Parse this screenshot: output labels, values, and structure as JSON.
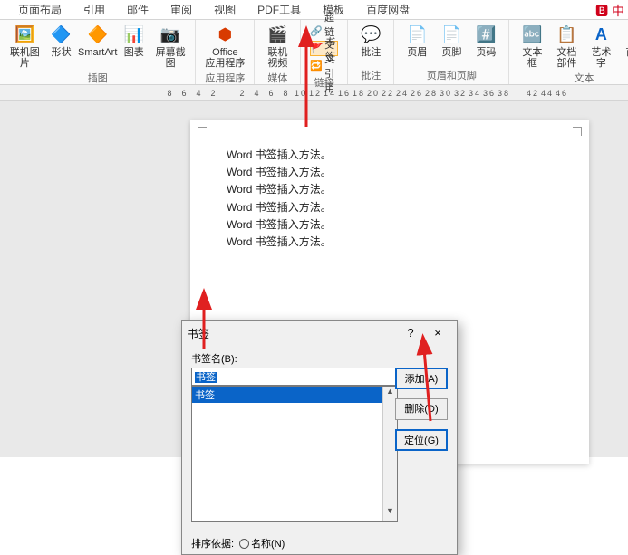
{
  "tabs": {
    "t0": "页面布局",
    "t1": "引用",
    "t2": "邮件",
    "t3": "审阅",
    "t4": "视图",
    "t5": "PDF工具",
    "t6": "模板",
    "t7": "百度网盘"
  },
  "logo_text": "中",
  "ribbon": {
    "illustrations": {
      "pic": "联机图片",
      "shape": "形状",
      "smartart": "SmartArt",
      "chart": "图表",
      "screenshot": "屏幕截图",
      "label": "插图"
    },
    "apps": {
      "office": "Office\n应用程序",
      "label": "应用程序"
    },
    "media": {
      "video": "联机视频",
      "label": "媒体"
    },
    "links": {
      "hyperlink": "超链接",
      "bookmark": "书签",
      "crossref": "交叉引用",
      "label": "链接"
    },
    "comments": {
      "comment": "批注",
      "label": "批注"
    },
    "headerfooter": {
      "header": "页眉",
      "footer": "页脚",
      "pagenum": "页码",
      "label": "页眉和页脚"
    },
    "text": {
      "textbox": "文本框",
      "quickparts": "文档部件",
      "wordart": "艺术字",
      "dropcap": "首字",
      "label": "文本"
    }
  },
  "ruler": [
    "8",
    "6",
    "4",
    "2",
    "",
    "2",
    "4",
    "6",
    "8",
    "10",
    "12",
    "14",
    "16",
    "18",
    "20",
    "22",
    "24",
    "26",
    "28",
    "30",
    "32",
    "34",
    "36",
    "38",
    "",
    "42",
    "44",
    "46"
  ],
  "document": {
    "l1": "Word 书签插入方法。",
    "l2": "Word 书签插入方法。",
    "l3": "Word 书签插入方法。",
    "l4": "Word 书签插入方法。",
    "l5": "Word 书签插入方法。",
    "l6": "Word 书签插入方法。"
  },
  "dialog": {
    "title": "书签",
    "help": "?",
    "close": "×",
    "fieldLabel": "书签名(B):",
    "inputValue": "书签",
    "listItem": "书签",
    "addBtn": "添加(A)",
    "deleteBtn": "删除(D)",
    "gotoBtn": "定位(G)",
    "sortLabel": "排序依据:",
    "sortOpt1": "名称(N)"
  }
}
